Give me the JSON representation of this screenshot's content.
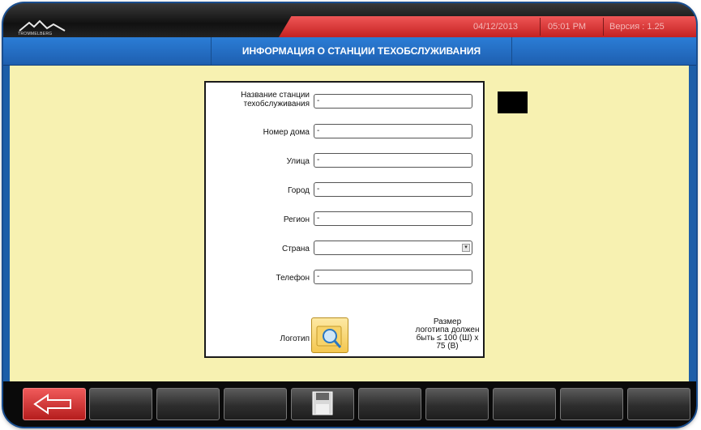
{
  "header": {
    "brand": "TROMMELBERG",
    "date": "04/12/2013",
    "time": "05:01 PM",
    "version": "Версия : 1.25"
  },
  "title": "ИНФОРМАЦИЯ О СТАНЦИИ ТЕХОБСЛУЖИВАНИЯ",
  "form": {
    "station_name": {
      "label_line1": "Название станции",
      "label_line2": "техобслуживания",
      "value": "-"
    },
    "house_number": {
      "label": "Номер дома",
      "value": "-"
    },
    "street": {
      "label": "Улица",
      "value": "-"
    },
    "city": {
      "label": "Город",
      "value": "-"
    },
    "region": {
      "label": "Регион",
      "value": "-"
    },
    "country": {
      "label": "Страна",
      "value": ""
    },
    "phone": {
      "label": "Телефон",
      "value": "-"
    },
    "logo": {
      "label": "Логотип",
      "note_lines": [
        "Размер",
        "логотипа должен",
        "быть ≤ 100 (Ш) x",
        "75 (В)"
      ]
    }
  },
  "toolbar": {
    "buttons": [
      "back",
      "empty",
      "empty",
      "empty",
      "save",
      "empty",
      "empty",
      "empty",
      "empty",
      "empty"
    ]
  },
  "colors": {
    "accent_blue": "#1e5fb0",
    "header_red": "#c42222",
    "background_yellow": "#f7f1b1"
  }
}
